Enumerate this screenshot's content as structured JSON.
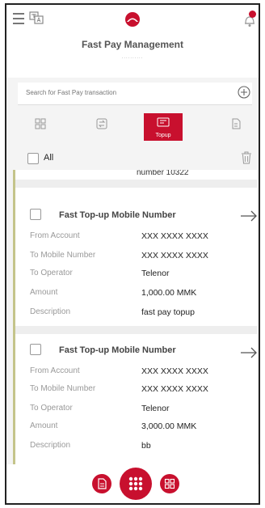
{
  "header": {
    "title": "Fast Pay Management",
    "subtitle": "..........",
    "icons": [
      "menu-icon",
      "language-icon",
      "bank-logo-icon",
      "notification-bell-icon"
    ],
    "accent_color": "#c8102e"
  },
  "search": {
    "placeholder": "Search for Fast Pay transaction",
    "value": ""
  },
  "tabs": [
    {
      "label": "",
      "icon": "grid-icon",
      "active": false
    },
    {
      "label": "",
      "icon": "transfer-icon",
      "active": false
    },
    {
      "label": "Topup",
      "icon": "topup-icon",
      "active": true
    },
    {
      "label": "",
      "icon": "bill-icon",
      "active": false
    }
  ],
  "select_all": {
    "label": "All",
    "checked": false
  },
  "list": {
    "previous_tail": "number 10322",
    "cards": [
      {
        "title": "Fast Top-up Mobile Number",
        "rows": [
          {
            "label": "From Account",
            "value": "XXX XXXX XXXX"
          },
          {
            "label": "To Mobile Number",
            "value": "XXX XXXX XXXX"
          },
          {
            "label": "To Operator",
            "value": "Telenor"
          },
          {
            "label": "Amount",
            "value": "1,000.00 MMK"
          },
          {
            "label": "Description",
            "value": "fast pay topup"
          }
        ]
      },
      {
        "title": "Fast Top-up Mobile Number",
        "rows": [
          {
            "label": "From Account",
            "value": "XXX XXXX XXXX"
          },
          {
            "label": "To Mobile Number",
            "value": "XXX XXXX XXXX"
          },
          {
            "label": "To Operator",
            "value": "Telenor"
          },
          {
            "label": "Amount",
            "value": "3,000.00 MMK"
          },
          {
            "label": "Description",
            "value": "bb"
          }
        ]
      }
    ]
  },
  "bottom_nav": {
    "items": [
      "document-icon",
      "apps-grid-icon",
      "qr-grid-icon"
    ]
  }
}
